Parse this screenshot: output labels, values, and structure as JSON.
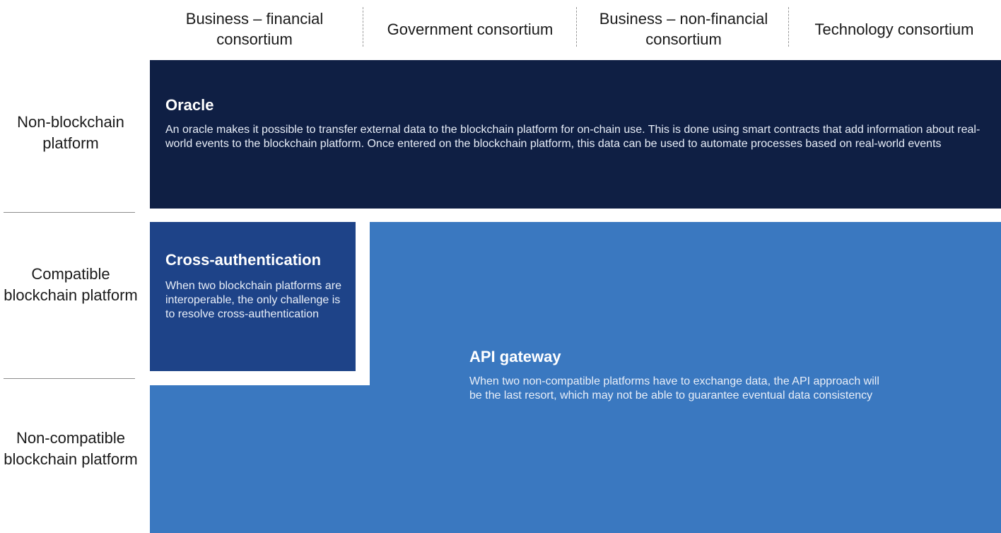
{
  "columns": [
    "Business – financial consortium",
    "Government consortium",
    "Business – non-financial consortium",
    "Technology consortium"
  ],
  "rows": [
    "Non-blockchain platform",
    "Compatible blockchain platform",
    "Non-compatible blockchain platform"
  ],
  "oracle": {
    "title": "Oracle",
    "text": "An oracle makes it possible to transfer external data to the blockchain platform for on-chain use. This is done using smart contracts that add information about real-world events to the blockchain platform. Once entered on the blockchain platform, this data can be used to automate processes based on real-world events"
  },
  "cross_auth": {
    "title": "Cross-authentication",
    "text": "When two blockchain platforms are interoperable, the only challenge is to resolve cross-authentication"
  },
  "api_gateway": {
    "title": "API gateway",
    "text": "When two non-compatible platforms have to exchange data, the API approach will be the last resort, which may not be able to guarantee eventual data consistency"
  },
  "colors": {
    "oracle": "#0f1f44",
    "cross_auth": "#1e4388",
    "api_gateway": "#3a78c0"
  }
}
